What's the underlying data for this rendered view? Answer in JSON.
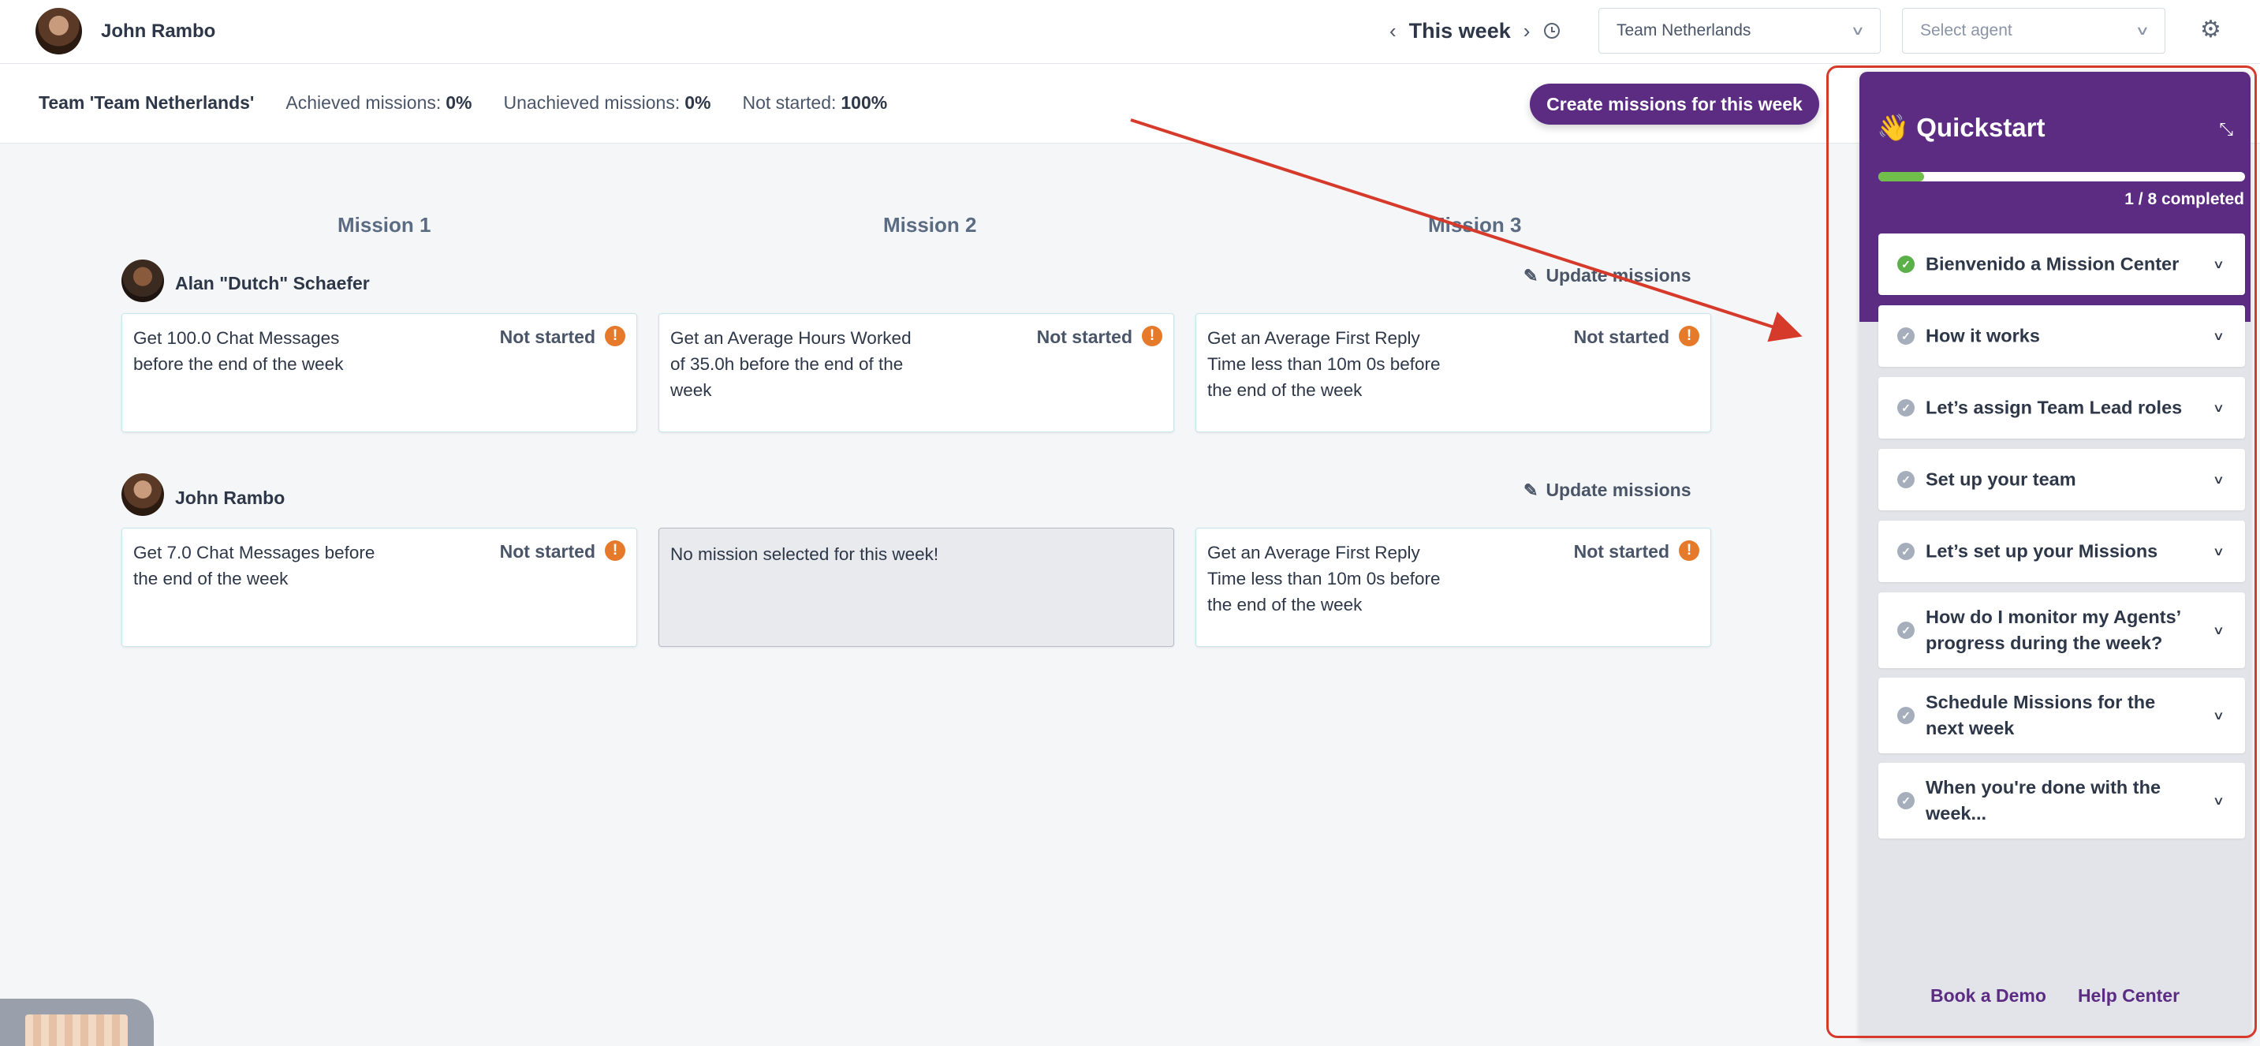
{
  "header": {
    "user_name": "John Rambo",
    "week_label": "This week",
    "prev_icon": "chevron-left-icon",
    "next_icon": "chevron-right-icon",
    "clock_icon": "clock-icon",
    "team_select": "Team Netherlands",
    "agent_select_placeholder": "Select agent",
    "settings_icon": "gear-icon"
  },
  "stats": {
    "team": "Team 'Team Netherlands'",
    "achieved_label": "Achieved missions:",
    "achieved_value": "0%",
    "unachieved_label": "Unachieved missions:",
    "unachieved_value": "0%",
    "not_started_label": "Not started:",
    "not_started_value": "100%",
    "create_button": "Create missions for this week"
  },
  "board": {
    "columns": [
      "Mission 1",
      "Mission 2",
      "Mission 3"
    ],
    "update_label": "Update missions",
    "agents": [
      {
        "name": "Alan \"Dutch\" Schaefer",
        "missions": [
          {
            "text": "Get 100.0 Chat Messages before the end of the week",
            "status": "Not started"
          },
          {
            "text": "Get an Average Hours Worked of 35.0h before the end of the week",
            "status": "Not started"
          },
          {
            "text": "Get an Average First Reply Time less than 10m 0s before the end of the week",
            "status": "Not started"
          }
        ]
      },
      {
        "name": "John Rambo",
        "missions": [
          {
            "text": "Get 7.0 Chat Messages before the end of the week",
            "status": "Not started"
          },
          {
            "text": "No mission selected for this week!",
            "status": ""
          },
          {
            "text": "Get an Average First Reply Time less than 10m 0s before the end of the week",
            "status": "Not started"
          }
        ]
      }
    ]
  },
  "quickstart": {
    "title": "👋 Quickstart",
    "progress_fraction": 0.125,
    "progress_text": "1 / 8 completed",
    "items": [
      {
        "label": "Bienvenido a Mission Center",
        "done": true
      },
      {
        "label": "How it works",
        "done": false
      },
      {
        "label": "Let’s assign Team Lead roles",
        "done": false
      },
      {
        "label": "Set up your team",
        "done": false
      },
      {
        "label": "Let’s set up your Missions",
        "done": false
      },
      {
        "label": "How do I monitor my Agents’ progress during the week?",
        "done": false
      },
      {
        "label": "Schedule Missions for the next week",
        "done": false
      },
      {
        "label": "When you're done with the week...",
        "done": false
      }
    ],
    "footer_links": [
      "Book a Demo",
      "Help Center"
    ]
  },
  "colors": {
    "brand_purple": "#5b2c82",
    "progress_green": "#6fbf4a",
    "warning_orange": "#e57a2a",
    "annotation_red": "#d63a2b"
  }
}
